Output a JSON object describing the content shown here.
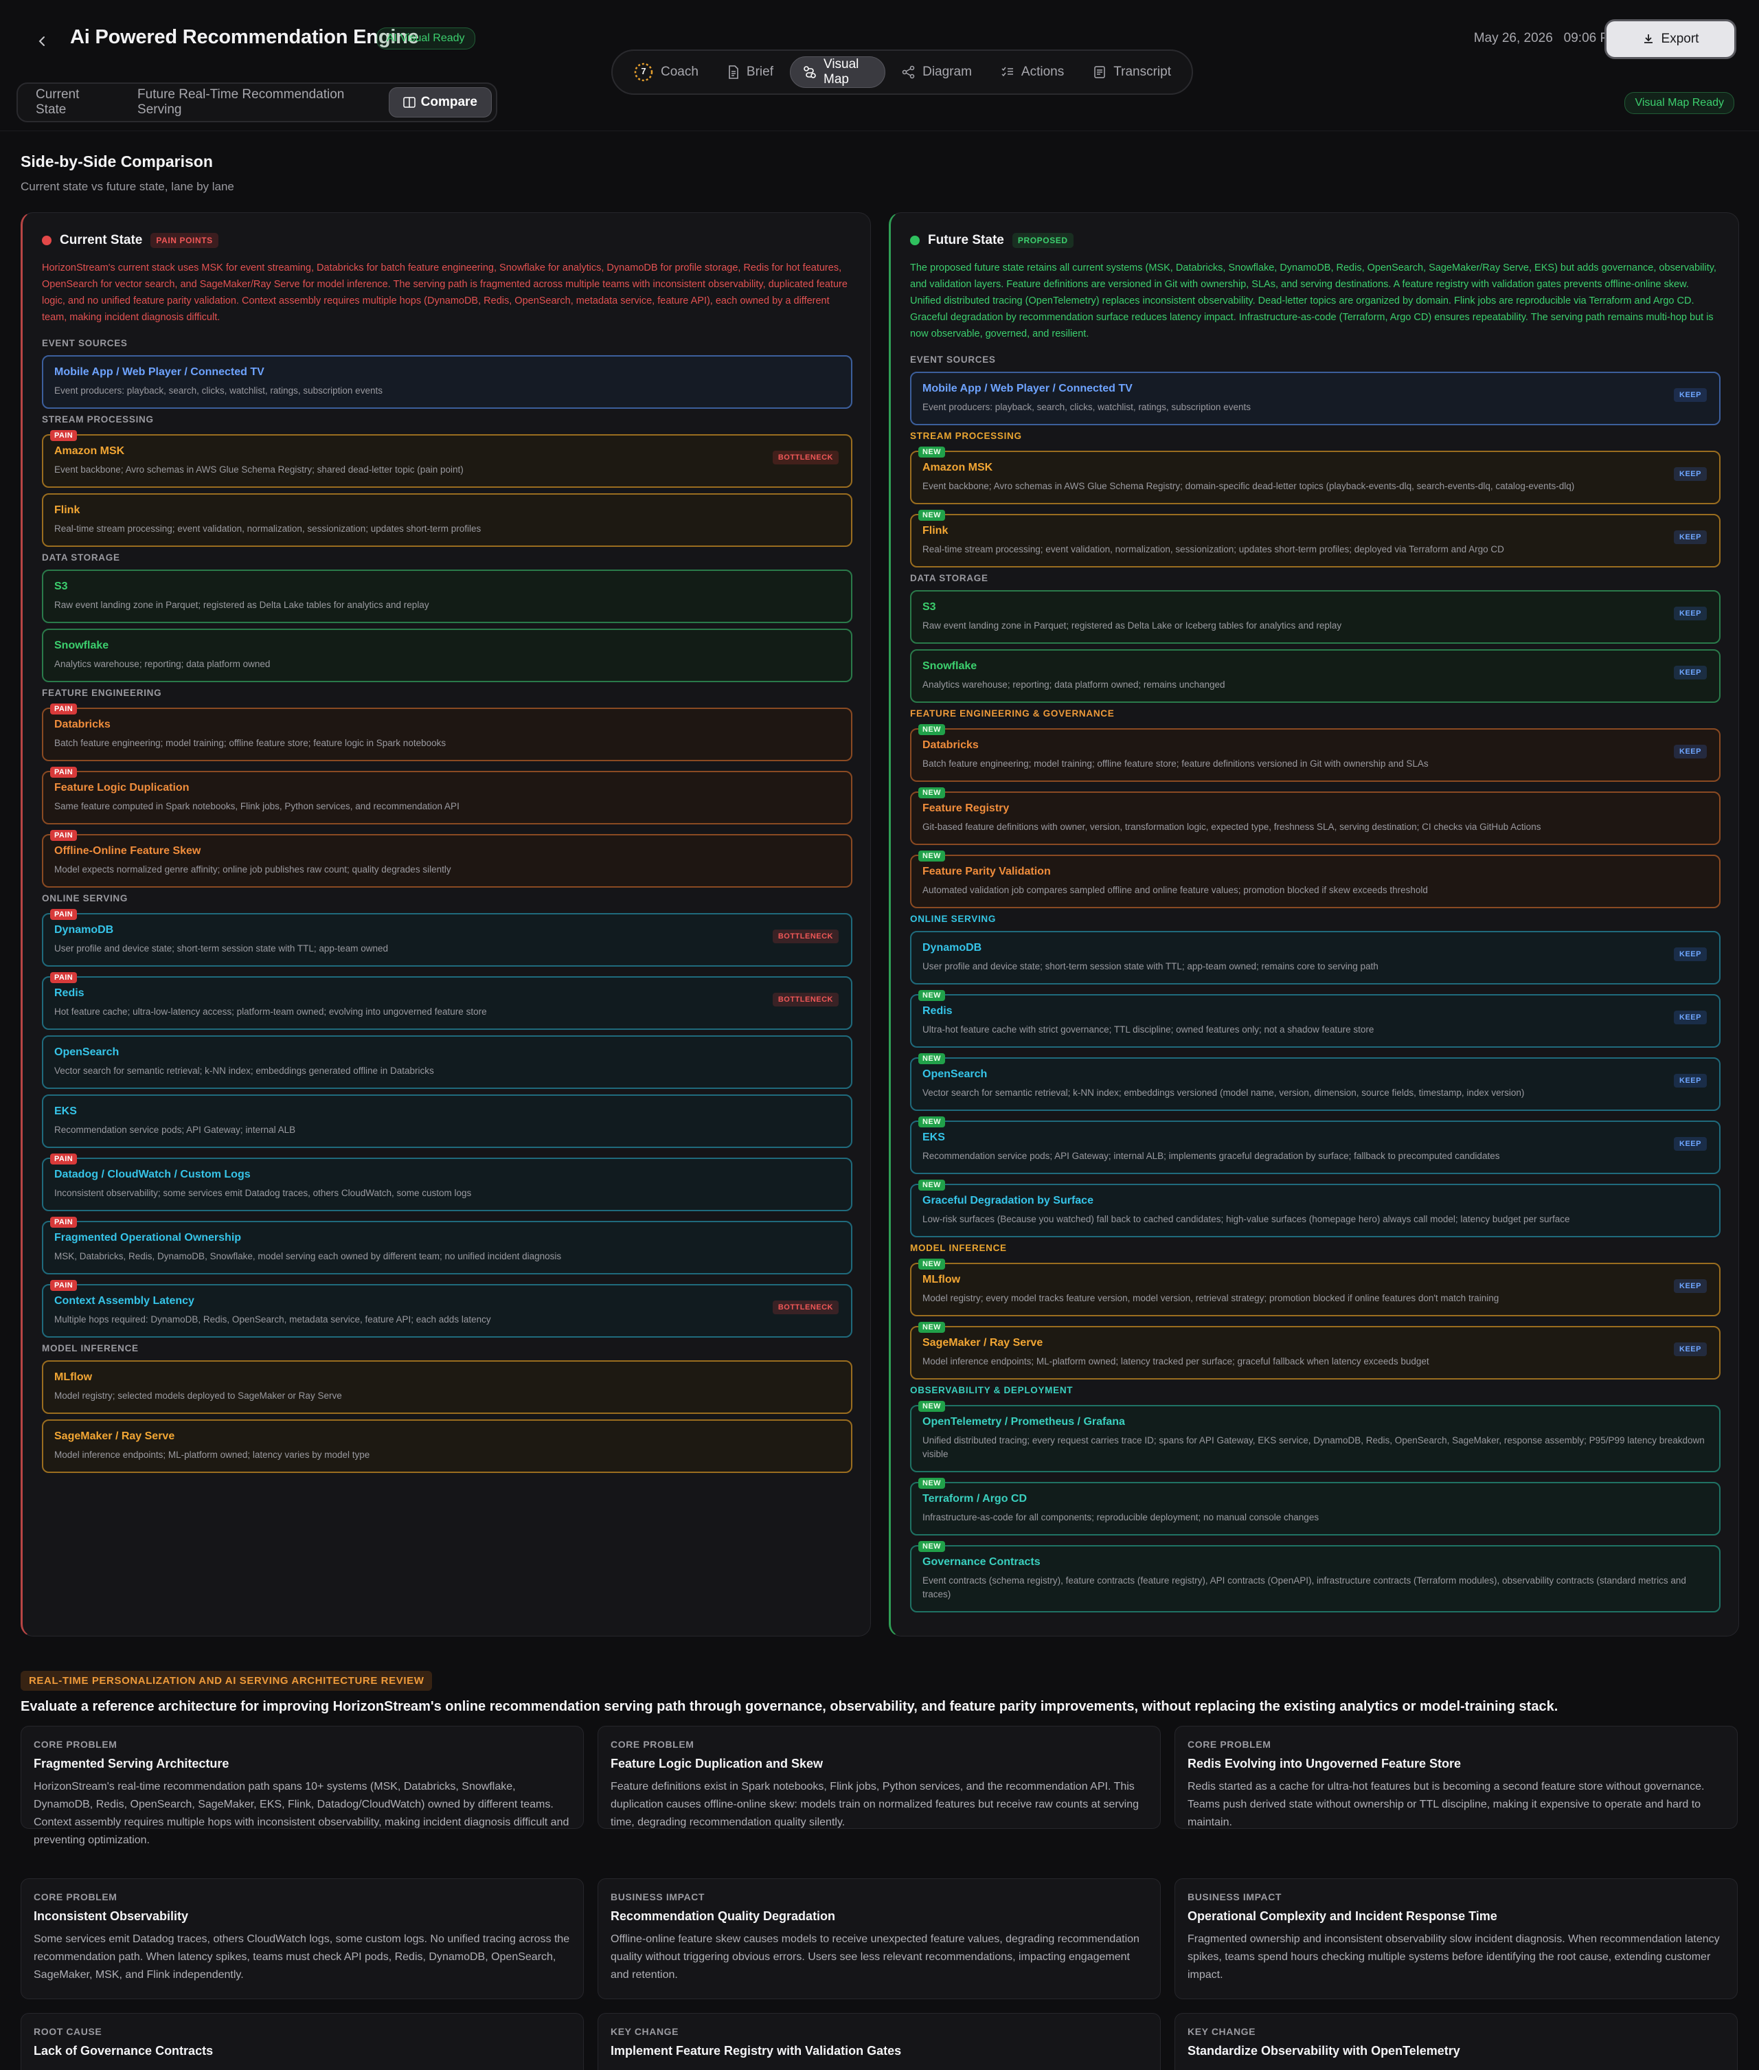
{
  "header": {
    "title": "Ai Powered Recommendation Engine",
    "status_badge": "AI Visual Ready",
    "date": "May 26, 2026",
    "time": "09:06 PM",
    "export_label": "Export",
    "nav": [
      {
        "label": "Coach",
        "icon": "coach-icon"
      },
      {
        "label": "Brief",
        "icon": "document-icon"
      },
      {
        "label": "Visual Map",
        "icon": "route-icon"
      },
      {
        "label": "Diagram",
        "icon": "share-nodes-icon"
      },
      {
        "label": "Actions",
        "icon": "checklist-icon"
      },
      {
        "label": "Transcript",
        "icon": "transcript-icon"
      }
    ],
    "coach_badge": "7",
    "active_nav": "Visual Map"
  },
  "view_tabs": [
    "Current State",
    "Future Real-Time Recommendation Serving",
    "Compare"
  ],
  "map_ready_badge": "Visual Map Ready",
  "comparison": {
    "title": "Side-by-Side Comparison",
    "subtitle": "Current state vs future state, lane by lane"
  },
  "current": {
    "name": "Current State",
    "tag": "PAIN POINTS",
    "description": "HorizonStream's current stack uses MSK for event streaming, Databricks for batch feature engineering, Snowflake for analytics, DynamoDB for profile storage, Redis for hot features, OpenSearch for vector search, and SageMaker/Ray Serve for model inference. The serving path is fragmented across multiple teams with inconsistent observability, duplicated feature logic, and no unified feature parity validation. Context assembly requires multiple hops (DynamoDB, Redis, OpenSearch, metadata service, feature API), each owned by a different team, making incident diagnosis difficult.",
    "sections": [
      {
        "label": "EVENT SOURCES",
        "nodes": [
          {
            "title": "Mobile App / Web Player / Connected TV",
            "desc": "Event producers: playback, search, clicks, watchlist, ratings, subscription events",
            "color": "blue",
            "pain": false,
            "bottleneck": false
          }
        ]
      },
      {
        "label": "STREAM PROCESSING",
        "nodes": [
          {
            "title": "Amazon MSK",
            "desc": "Event backbone; Avro schemas in AWS Glue Schema Registry; shared dead-letter topic (pain point)",
            "color": "amber",
            "pain": true,
            "bottleneck": true
          },
          {
            "title": "Flink",
            "desc": "Real-time stream processing; event validation, normalization, sessionization; updates short-term profiles",
            "color": "amber",
            "pain": false,
            "bottleneck": false
          }
        ]
      },
      {
        "label": "DATA STORAGE",
        "nodes": [
          {
            "title": "S3",
            "desc": "Raw event landing zone in Parquet; registered as Delta Lake tables for analytics and replay",
            "color": "green",
            "pain": false,
            "bottleneck": false
          },
          {
            "title": "Snowflake",
            "desc": "Analytics warehouse; reporting; data platform owned",
            "color": "green",
            "pain": false,
            "bottleneck": false
          }
        ]
      },
      {
        "label": "FEATURE ENGINEERING",
        "nodes": [
          {
            "title": "Databricks",
            "desc": "Batch feature engineering; model training; offline feature store; feature logic in Spark notebooks",
            "color": "orange",
            "pain": true,
            "bottleneck": false
          },
          {
            "title": "Feature Logic Duplication",
            "desc": "Same feature computed in Spark notebooks, Flink jobs, Python services, and recommendation API",
            "color": "orange",
            "pain": true,
            "bottleneck": false
          },
          {
            "title": "Offline-Online Feature Skew",
            "desc": "Model expects normalized genre affinity; online job publishes raw count; quality degrades silently",
            "color": "orange",
            "pain": true,
            "bottleneck": false
          }
        ]
      },
      {
        "label": "ONLINE SERVING",
        "nodes": [
          {
            "title": "DynamoDB",
            "desc": "User profile and device state; short-term session state with TTL; app-team owned",
            "color": "cyan",
            "pain": true,
            "bottleneck": true
          },
          {
            "title": "Redis",
            "desc": "Hot feature cache; ultra-low-latency access; platform-team owned; evolving into ungoverned feature store",
            "color": "cyan",
            "pain": true,
            "bottleneck": true
          },
          {
            "title": "OpenSearch",
            "desc": "Vector search for semantic retrieval; k-NN index; embeddings generated offline in Databricks",
            "color": "cyan",
            "pain": false,
            "bottleneck": false
          },
          {
            "title": "EKS",
            "desc": "Recommendation service pods; API Gateway; internal ALB",
            "color": "cyan",
            "pain": false,
            "bottleneck": false
          },
          {
            "title": "Datadog / CloudWatch / Custom Logs",
            "desc": "Inconsistent observability; some services emit Datadog traces, others CloudWatch, some custom logs",
            "color": "cyan",
            "pain": true,
            "bottleneck": false
          },
          {
            "title": "Fragmented Operational Ownership",
            "desc": "MSK, Databricks, Redis, DynamoDB, Snowflake, model serving each owned by different team; no unified incident diagnosis",
            "color": "cyan",
            "pain": true,
            "bottleneck": false
          },
          {
            "title": "Context Assembly Latency",
            "desc": "Multiple hops required: DynamoDB, Redis, OpenSearch, metadata service, feature API; each adds latency",
            "color": "cyan",
            "pain": true,
            "bottleneck": true
          }
        ]
      },
      {
        "label": "MODEL INFERENCE",
        "nodes": [
          {
            "title": "MLflow",
            "desc": "Model registry; selected models deployed to SageMaker or Ray Serve",
            "color": "amber",
            "pain": false,
            "bottleneck": false
          },
          {
            "title": "SageMaker / Ray Serve",
            "desc": "Model inference endpoints; ML-platform owned; latency varies by model type",
            "color": "amber",
            "pain": false,
            "bottleneck": false
          }
        ]
      }
    ]
  },
  "future": {
    "name": "Future State",
    "tag": "PROPOSED",
    "description": "The proposed future state retains all current systems (MSK, Databricks, Snowflake, DynamoDB, Redis, OpenSearch, SageMaker/Ray Serve, EKS) but adds governance, observability, and validation layers. Feature definitions are versioned in Git with ownership, SLAs, and serving destinations. A feature registry with validation gates prevents offline-online skew. Unified distributed tracing (OpenTelemetry) replaces inconsistent observability. Dead-letter topics are organized by domain. Flink jobs are reproducible via Terraform and Argo CD. Graceful degradation by recommendation surface reduces latency impact. Infrastructure-as-code (Terraform, Argo CD) ensures repeatability. The serving path remains multi-hop but is now observable, governed, and resilient.",
    "sections": [
      {
        "label": "EVENT SOURCES",
        "tone": "gray",
        "nodes": [
          {
            "title": "Mobile App / Web Player / Connected TV",
            "desc": "Event producers: playback, search, clicks, watchlist, ratings, subscription events",
            "color": "blue",
            "new": false,
            "keep": true
          }
        ]
      },
      {
        "label": "STREAM PROCESSING",
        "tone": "yellow",
        "nodes": [
          {
            "title": "Amazon MSK",
            "desc": "Event backbone; Avro schemas in AWS Glue Schema Registry; domain-specific dead-letter topics (playback-events-dlq, search-events-dlq, catalog-events-dlq)",
            "color": "amber",
            "new": true,
            "keep": true
          },
          {
            "title": "Flink",
            "desc": "Real-time stream processing; event validation, normalization, sessionization; updates short-term profiles; deployed via Terraform and Argo CD",
            "color": "amber",
            "new": true,
            "keep": true
          }
        ]
      },
      {
        "label": "DATA STORAGE",
        "tone": "gray",
        "nodes": [
          {
            "title": "S3",
            "desc": "Raw event landing zone in Parquet; registered as Delta Lake or Iceberg tables for analytics and replay",
            "color": "green",
            "new": false,
            "keep": true
          },
          {
            "title": "Snowflake",
            "desc": "Analytics warehouse; reporting; data platform owned; remains unchanged",
            "color": "green",
            "new": false,
            "keep": true
          }
        ]
      },
      {
        "label": "FEATURE ENGINEERING & GOVERNANCE",
        "tone": "orange",
        "nodes": [
          {
            "title": "Databricks",
            "desc": "Batch feature engineering; model training; offline feature store; feature definitions versioned in Git with ownership and SLAs",
            "color": "orange",
            "new": true,
            "keep": true
          },
          {
            "title": "Feature Registry",
            "desc": "Git-based feature definitions with owner, version, transformation logic, expected type, freshness SLA, serving destination; CI checks via GitHub Actions",
            "color": "orange",
            "new": true,
            "keep": false
          },
          {
            "title": "Feature Parity Validation",
            "desc": "Automated validation job compares sampled offline and online feature values; promotion blocked if skew exceeds threshold",
            "color": "orange",
            "new": true,
            "keep": false
          }
        ]
      },
      {
        "label": "ONLINE SERVING",
        "tone": "cyan",
        "nodes": [
          {
            "title": "DynamoDB",
            "desc": "User profile and device state; short-term session state with TTL; app-team owned; remains core to serving path",
            "color": "cyan",
            "new": false,
            "keep": true
          },
          {
            "title": "Redis",
            "desc": "Ultra-hot feature cache with strict governance; TTL discipline; owned features only; not a shadow feature store",
            "color": "cyan",
            "new": true,
            "keep": true
          },
          {
            "title": "OpenSearch",
            "desc": "Vector search for semantic retrieval; k-NN index; embeddings versioned (model name, version, dimension, source fields, timestamp, index version)",
            "color": "cyan",
            "new": true,
            "keep": true
          },
          {
            "title": "EKS",
            "desc": "Recommendation service pods; API Gateway; internal ALB; implements graceful degradation by surface; fallback to precomputed candidates",
            "color": "cyan",
            "new": true,
            "keep": true
          },
          {
            "title": "Graceful Degradation by Surface",
            "desc": "Low-risk surfaces (Because you watched) fall back to cached candidates; high-value surfaces (homepage hero) always call model; latency budget per surface",
            "color": "cyan",
            "new": true,
            "keep": false
          }
        ]
      },
      {
        "label": "MODEL INFERENCE",
        "tone": "yellow",
        "nodes": [
          {
            "title": "MLflow",
            "desc": "Model registry; every model tracks feature version, model version, retrieval strategy; promotion blocked if online features don't match training",
            "color": "amber",
            "new": true,
            "keep": true
          },
          {
            "title": "SageMaker / Ray Serve",
            "desc": "Model inference endpoints; ML-platform owned; latency tracked per surface; graceful fallback when latency exceeds budget",
            "color": "amber",
            "new": true,
            "keep": true
          }
        ]
      },
      {
        "label": "OBSERVABILITY & DEPLOYMENT",
        "tone": "teal",
        "nodes": [
          {
            "title": "OpenTelemetry / Prometheus / Grafana",
            "desc": "Unified distributed tracing; every request carries trace ID; spans for API Gateway, EKS service, DynamoDB, Redis, OpenSearch, SageMaker, response assembly; P95/P99 latency breakdown visible",
            "color": "teal",
            "new": true,
            "keep": false
          },
          {
            "title": "Terraform / Argo CD",
            "desc": "Infrastructure-as-code for all components; reproducible deployment; no manual console changes",
            "color": "teal",
            "new": true,
            "keep": false
          },
          {
            "title": "Governance Contracts",
            "desc": "Event contracts (schema registry), feature contracts (feature registry), API contracts (OpenAPI), infrastructure contracts (Terraform modules), observability contracts (standard metrics and traces)",
            "color": "teal",
            "new": true,
            "keep": false
          }
        ]
      }
    ]
  },
  "labels": {
    "pain": "PAIN",
    "new": "NEW",
    "bottleneck": "BOTTLENECK",
    "keep": "KEEP"
  },
  "review": {
    "tag": "REAL-TIME PERSONALIZATION AND AI SERVING ARCHITECTURE REVIEW",
    "title": "Evaluate a reference architecture for improving HorizonStream's online recommendation serving path through governance, observability, and feature parity improvements, without replacing the existing analytics or model-training stack.",
    "cards": [
      {
        "kicker": "CORE PROBLEM",
        "title": "Fragmented Serving Architecture",
        "body": "HorizonStream's real-time recommendation path spans 10+ systems (MSK, Databricks, Snowflake, DynamoDB, Redis, OpenSearch, SageMaker, EKS, Flink, Datadog/CloudWatch) owned by different teams. Context assembly requires multiple hops with inconsistent observability, making incident diagnosis difficult and preventing optimization."
      },
      {
        "kicker": "CORE PROBLEM",
        "title": "Feature Logic Duplication and Skew",
        "body": "Feature definitions exist in Spark notebooks, Flink jobs, Python services, and the recommendation API. This duplication causes offline-online skew: models train on normalized features but receive raw counts at serving time, degrading recommendation quality silently."
      },
      {
        "kicker": "CORE PROBLEM",
        "title": "Redis Evolving into Ungoverned Feature Store",
        "body": "Redis started as a cache for ultra-hot features but is becoming a second feature store without governance. Teams push derived state without ownership or TTL discipline, making it expensive to operate and hard to maintain."
      },
      {
        "kicker": "CORE PROBLEM",
        "title": "Inconsistent Observability",
        "body": "Some services emit Datadog traces, others CloudWatch logs, some custom logs. No unified tracing across the recommendation path. When latency spikes, teams must check API pods, Redis, DynamoDB, OpenSearch, SageMaker, MSK, and Flink independently."
      },
      {
        "kicker": "BUSINESS IMPACT",
        "title": "Recommendation Quality Degradation",
        "body": "Offline-online feature skew causes models to receive unexpected feature values, degrading recommendation quality without triggering obvious errors. Users see less relevant recommendations, impacting engagement and retention."
      },
      {
        "kicker": "BUSINESS IMPACT",
        "title": "Operational Complexity and Incident Response Time",
        "body": "Fragmented ownership and inconsistent observability slow incident diagnosis. When recommendation latency spikes, teams spend hours checking multiple systems before identifying the root cause, extending customer impact."
      },
      {
        "kicker": "ROOT CAUSE",
        "title": "Lack of Governance Contracts",
        "body": ""
      },
      {
        "kicker": "KEY CHANGE",
        "title": "Implement Feature Registry with Validation Gates",
        "body": ""
      },
      {
        "kicker": "KEY CHANGE",
        "title": "Standardize Observability with OpenTelemetry",
        "body": ""
      }
    ]
  }
}
